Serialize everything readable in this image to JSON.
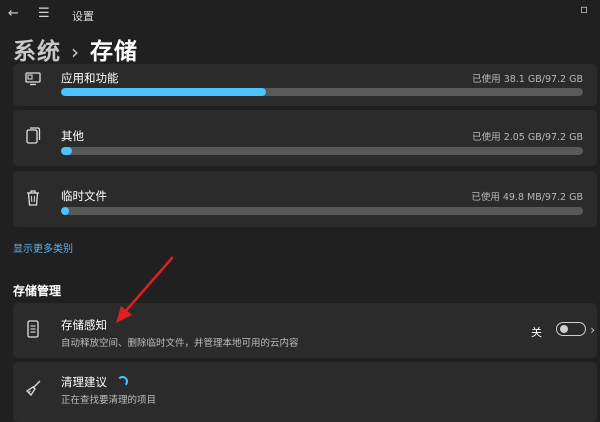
{
  "window": {
    "back_icon": "back-arrow-icon",
    "menu_icon": "hamburger-menu-icon",
    "title": "设置"
  },
  "breadcrumb": {
    "parent": "系统",
    "separator": "›",
    "current": "存储"
  },
  "categories": [
    {
      "label": "应用和功能",
      "usage": "已使用 38.1 GB/97.2 GB",
      "fraction": 0.392,
      "icon": "apps-monitor-icon"
    },
    {
      "label": "其他",
      "usage": "已使用 2.05 GB/97.2 GB",
      "fraction": 0.021,
      "icon": "other-files-icon"
    },
    {
      "label": "临时文件",
      "usage": "已使用 49.8 MB/97.2 GB",
      "fraction": 0.0005,
      "icon": "trash-icon"
    }
  ],
  "show_more_link": "显示更多类别",
  "management": {
    "heading": "存储管理",
    "storage_sense": {
      "title": "存储感知",
      "description": "自动释放空间、删除临时文件，并管理本地可用的云内容",
      "toggle_label": "关",
      "toggle_on": false,
      "icon": "storage-drive-icon"
    },
    "cleanup": {
      "title": "清理建议",
      "description": "正在查找要清理的项目",
      "icon": "broom-icon"
    }
  },
  "colors": {
    "background": "#202020",
    "card": "#2b2b2b",
    "accent": "#4cc2ff",
    "bar_track": "#595959",
    "annotation_arrow": "#e02020"
  }
}
